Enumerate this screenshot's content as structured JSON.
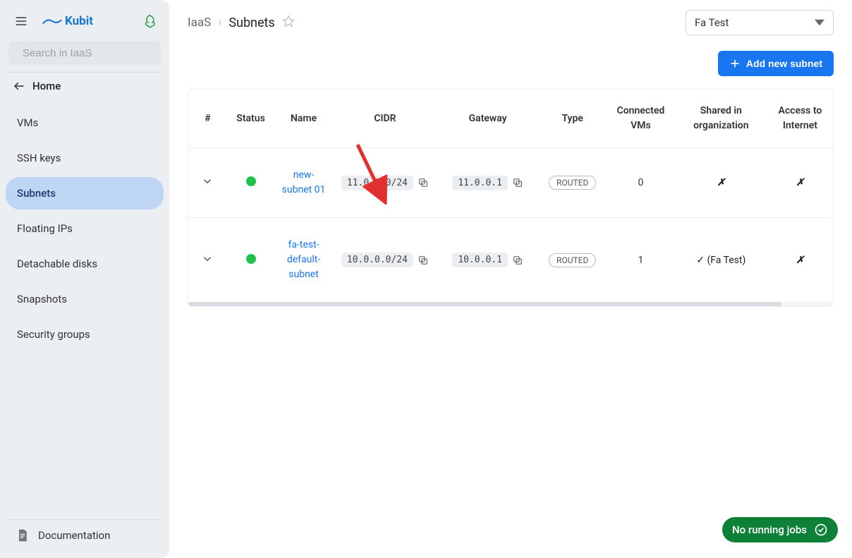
{
  "brand": "Kubit",
  "search": {
    "placeholder": "Search in IaaS"
  },
  "home_label": "Home",
  "sidebar": {
    "items": [
      {
        "label": "VMs"
      },
      {
        "label": "SSH keys"
      },
      {
        "label": "Subnets"
      },
      {
        "label": "Floating IPs"
      },
      {
        "label": "Detachable disks"
      },
      {
        "label": "Snapshots"
      },
      {
        "label": "Security groups"
      }
    ],
    "active_index": 2
  },
  "documentation_label": "Documentation",
  "breadcrumb": {
    "root": "IaaS",
    "current": "Subnets"
  },
  "project_select": {
    "value": "Fa Test"
  },
  "add_button_label": "Add new subnet",
  "table": {
    "columns": {
      "n": "#",
      "status": "Status",
      "name": "Name",
      "cidr": "CIDR",
      "gateway": "Gateway",
      "type": "Type",
      "connected": "Connected VMs",
      "shared": "Shared in organization",
      "access": "Access to Internet"
    },
    "rows": [
      {
        "status": "up",
        "name": "new-subnet 01",
        "cidr": "11.0.0.0/24",
        "gateway": "11.0.0.1",
        "type": "ROUTED",
        "connected_vms": "0",
        "shared": "✗",
        "access": "✗"
      },
      {
        "status": "up",
        "name": "fa-test-default-subnet",
        "cidr": "10.0.0.0/24",
        "gateway": "10.0.0.1",
        "type": "ROUTED",
        "connected_vms": "1",
        "shared": "✓ (Fa Test)",
        "access": "✗"
      }
    ]
  },
  "jobs_chip": "No running jobs",
  "colors": {
    "accent": "#1976f0",
    "status_ok": "#22c14b",
    "sidebar_bg": "#eceff1",
    "active_nav_bg": "#bfd5f4",
    "jobs_chip_bg": "#0f8038"
  }
}
